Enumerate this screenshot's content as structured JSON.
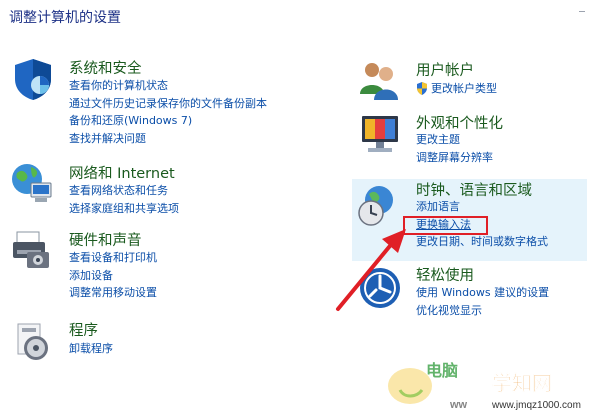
{
  "page": {
    "title": "调整计算机的设置"
  },
  "categories": {
    "security": {
      "title": "系统和安全",
      "links": [
        "查看你的计算机状态",
        "通过文件历史记录保存你的文件备份副本",
        "备份和还原(Windows 7)",
        "查找并解决问题"
      ]
    },
    "network": {
      "title": "网络和 Internet",
      "links": [
        "查看网络状态和任务",
        "选择家庭组和共享选项"
      ]
    },
    "hardware": {
      "title": "硬件和声音",
      "links": [
        "查看设备和打印机",
        "添加设备",
        "调整常用移动设置"
      ]
    },
    "programs": {
      "title": "程序",
      "links": [
        "卸载程序"
      ]
    },
    "accounts": {
      "title": "用户帐户",
      "links": [
        "更改帐户类型"
      ]
    },
    "appearance": {
      "title": "外观和个性化",
      "links": [
        "更改主题",
        "调整屏幕分辨率"
      ]
    },
    "clock": {
      "title": "时钟、语言和区域",
      "links": [
        "添加语言",
        "更换输入法",
        "更改日期、时间或数字格式"
      ]
    },
    "ease": {
      "title": "轻松使用",
      "links": [
        "使用 Windows 建议的设置",
        "优化视觉显示"
      ]
    }
  },
  "watermark": {
    "brand_left": "电脑",
    "brand_right": "学知网",
    "url": "www.jmqz1000.com"
  },
  "colors": {
    "title_green": "#1a5a1e",
    "link_blue": "#0b4ea8",
    "highlight": "#e5f3fb",
    "annotation_red": "#e01f26"
  }
}
